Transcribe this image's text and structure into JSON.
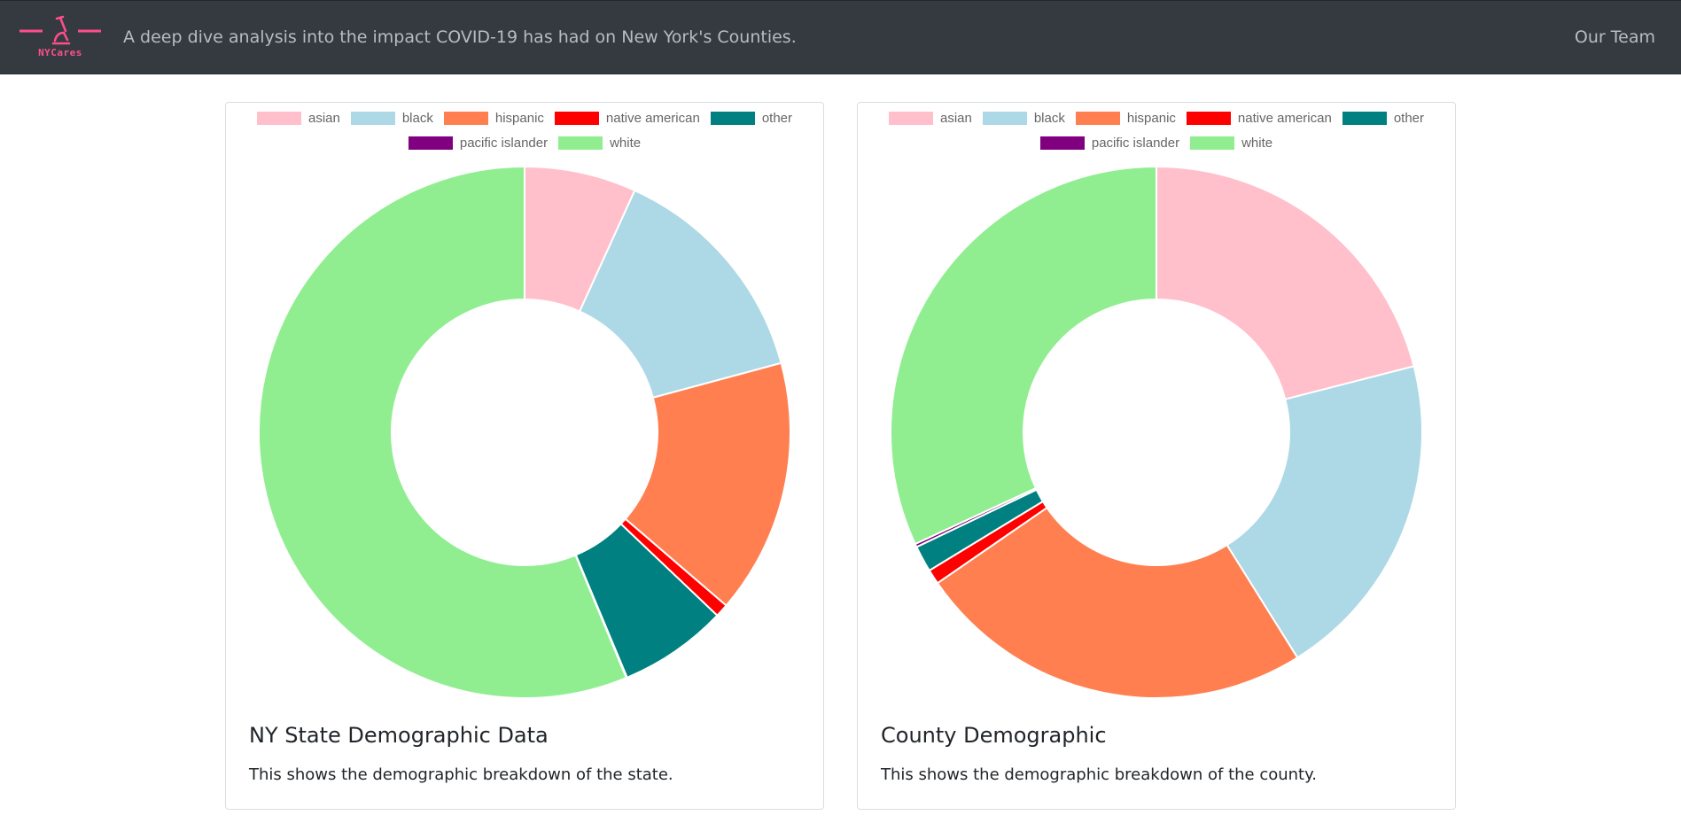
{
  "header": {
    "brand": "NYCares",
    "tagline": "A deep dive analysis into the impact COVID-19 has had on New York's Counties.",
    "nav_link": "Our Team",
    "brand_color": "#ff4f8b"
  },
  "cards": [
    {
      "title": "NY State Demographic Data",
      "description": "This shows the demographic breakdown of the state."
    },
    {
      "title": "County Demographic",
      "description": "This shows the demographic breakdown of the county."
    }
  ],
  "chart_data": [
    {
      "type": "pie",
      "variant": "doughnut",
      "labels": [
        "asian",
        "black",
        "hispanic",
        "native american",
        "other",
        "pacific islander",
        "white"
      ],
      "colors": [
        "#ffc0cb",
        "#add8e6",
        "#ff7f50",
        "#ff0000",
        "#008080",
        "#800080",
        "#90ee90"
      ],
      "values": [
        6.8,
        14.0,
        15.5,
        0.8,
        6.6,
        0.05,
        56.25
      ],
      "legend_position": "top"
    },
    {
      "type": "pie",
      "variant": "doughnut",
      "labels": [
        "asian",
        "black",
        "hispanic",
        "native american",
        "other",
        "pacific islander",
        "white"
      ],
      "colors": [
        "#ffc0cb",
        "#add8e6",
        "#ff7f50",
        "#ff0000",
        "#008080",
        "#800080",
        "#90ee90"
      ],
      "values": [
        21.0,
        20.1,
        24.3,
        0.9,
        1.6,
        0.2,
        31.9
      ],
      "legend_position": "top"
    }
  ]
}
